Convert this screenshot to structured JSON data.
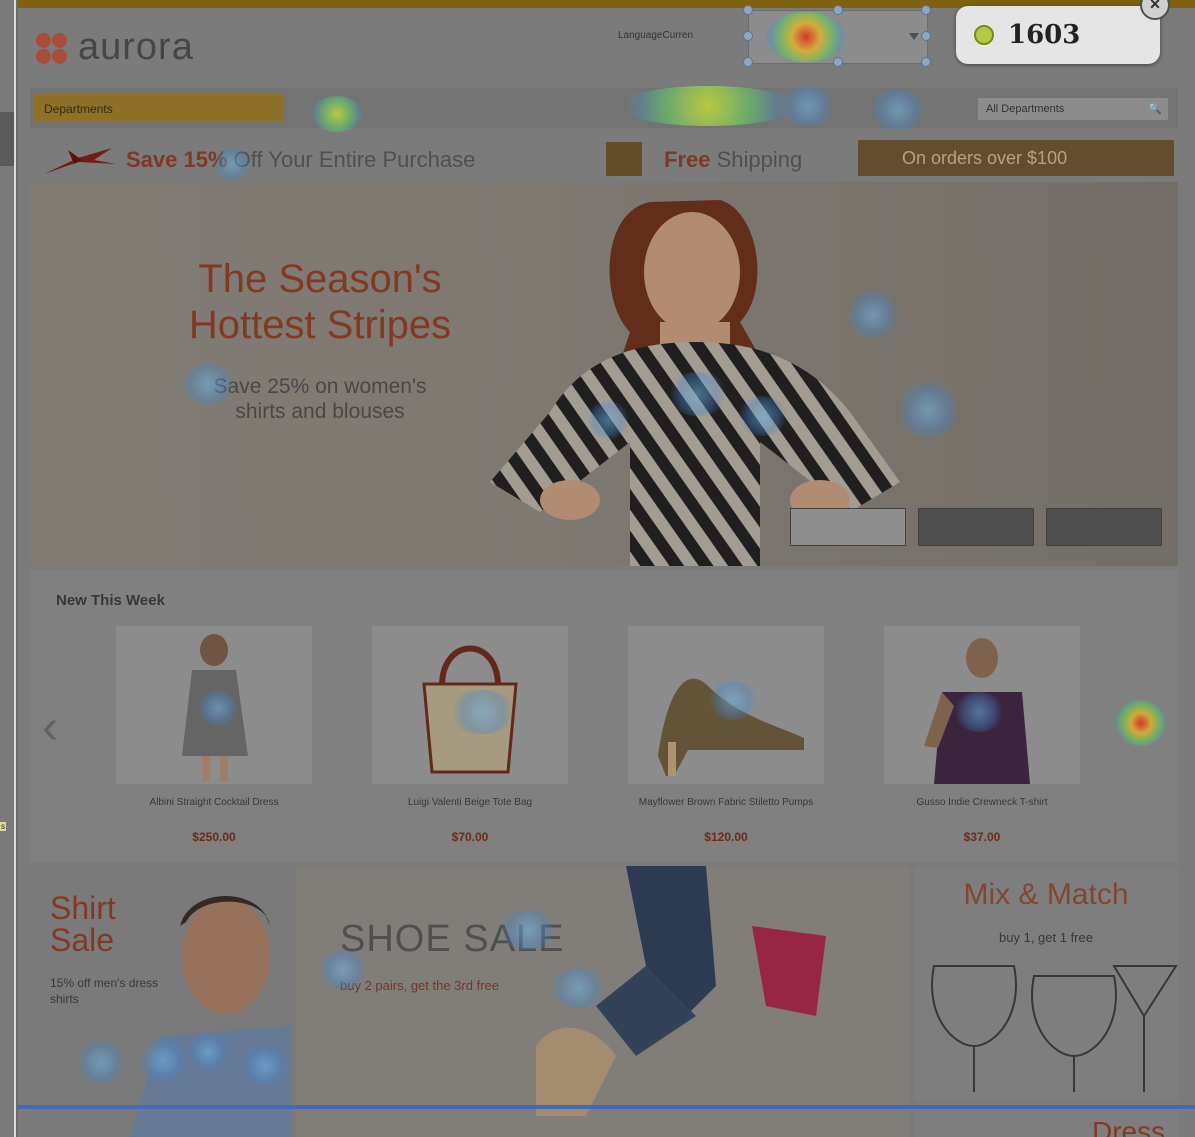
{
  "header": {
    "logo_text": "aurora",
    "language_label": "LanguageCurren",
    "language_value": "",
    "click_count": "1603",
    "close_label": "×"
  },
  "nav": {
    "departments_label": "Departments",
    "search_placeholder": "All Departments",
    "search_icon": "magnifier-icon"
  },
  "promo": {
    "save_bold": "Save 15%",
    "save_rest": " Off Your Entire Purchase",
    "free_bold": "Free",
    "free_rest": " Shipping",
    "orders": "On orders over $100"
  },
  "hero": {
    "title_line1": "The Season's",
    "title_line2": "Hottest Stripes",
    "sub_line1": "Save 25% on women's",
    "sub_line2": "shirts and blouses"
  },
  "new_this_week": {
    "heading": "New This Week",
    "products": [
      {
        "name": "Albini Straight Cocktail Dress",
        "price": "$250.00"
      },
      {
        "name": "Luigi Valenti Beige Tote Bag",
        "price": "$70.00"
      },
      {
        "name": "Mayflower Brown Fabric Stiletto Pumps",
        "price": "$120.00"
      },
      {
        "name": "Gusso Indie Crewneck T-shirt",
        "price": "$37.00"
      }
    ]
  },
  "banners": {
    "shirt_title1": "Shirt",
    "shirt_title2": "Sale",
    "shirt_sub": "15% off men's dress shirts",
    "shoe_title": "SHOE SALE",
    "shoe_sub": "buy 2 pairs, get the 3rd free",
    "mix_title": "Mix & Match",
    "mix_sub": "buy 1, get 1 free",
    "dress_title": "Dress"
  },
  "left_strip_tag": "s",
  "colors": {
    "brand_red": "#8e3c22",
    "gold": "#9c7a2a",
    "heat_hot": "#ff2a1e",
    "heat_cool": "#64a0e6"
  }
}
